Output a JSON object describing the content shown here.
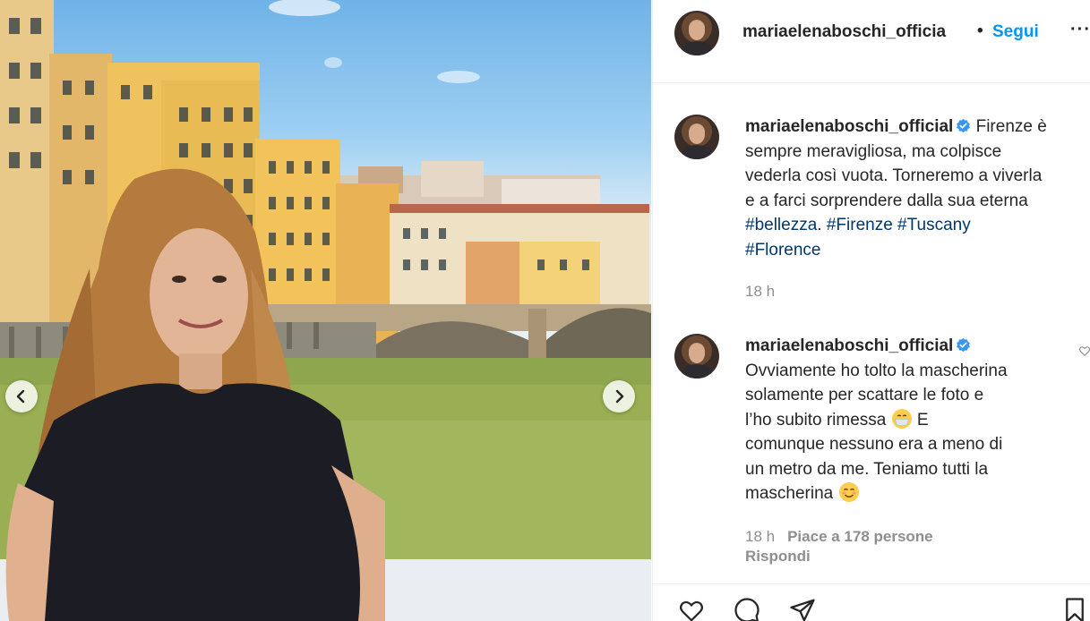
{
  "post": {
    "username": "mariaelenaboschi_officia",
    "separator": "•",
    "follow_label": "Segui",
    "more_label": "···"
  },
  "caption": {
    "username": "mariaelenaboschi_official",
    "text_1": "Firenze è",
    "text_2": "sempre meravigliosa, ma colpisce",
    "text_3": "vederla così vuota. Torneremo a viverla",
    "text_4": "e a farci sorprendere dalla sua eterna",
    "hashtag_1": "#bellezza",
    "period": ".",
    "hashtag_2": "#Firenze",
    "hashtag_3": "#Tuscany",
    "hashtag_4": "#Florence",
    "time": "18 h"
  },
  "comment": {
    "username": "mariaelenaboschi_official",
    "line_1": "Ovviamente ho tolto la mascherina",
    "line_2": "solamente per scattare le foto e",
    "line_3": "l’ho subito rimessa",
    "line_3b": "E",
    "line_4": "comunque nessuno era a meno di",
    "line_5": "un metro da me. Teniamo tutti la",
    "line_6": "mascherina",
    "time": "18 h",
    "likes": "Piace a 178 persone",
    "reply_label": "Rispondi"
  },
  "icons": {
    "prev": "chevron-left-icon",
    "next": "chevron-right-icon",
    "verified": "verified-badge-icon",
    "like": "heart-icon",
    "comment": "comment-icon",
    "share": "paper-plane-icon",
    "save": "bookmark-icon"
  },
  "colors": {
    "link": "#0095f6",
    "hashtag": "#00376b",
    "muted": "#8e8e8e",
    "text": "#262626"
  }
}
